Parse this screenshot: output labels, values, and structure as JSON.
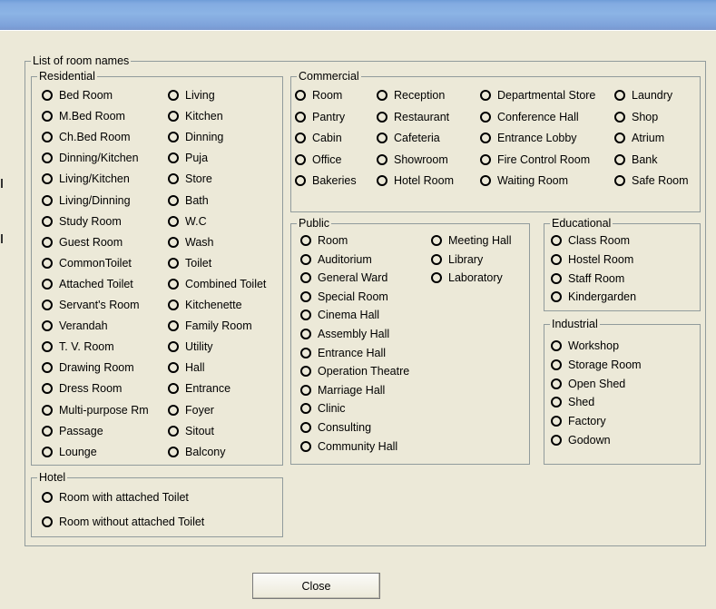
{
  "group_title": "List of room names",
  "residential": {
    "title": "Residential",
    "col1": [
      "Bed Room",
      "M.Bed Room",
      "Ch.Bed Room",
      "Dinning/Kitchen",
      "Living/Kitchen",
      "Living/Dinning",
      "Study Room",
      "Guest Room",
      "CommonToilet",
      "Attached Toilet",
      "Servant's Room",
      "Verandah",
      "T. V. Room",
      "Drawing Room",
      "Dress Room",
      "Multi-purpose Rm",
      "Passage",
      "Lounge"
    ],
    "col2": [
      "Living",
      "Kitchen",
      "Dinning",
      "Puja",
      "Store",
      "Bath",
      "W.C",
      "Wash",
      "Toilet",
      "Combined Toilet",
      "Kitchenette",
      "Family Room",
      "Utility",
      "Hall",
      "Entrance",
      "Foyer",
      "Sitout",
      "Balcony"
    ]
  },
  "commercial": {
    "title": "Commercial",
    "col1": [
      "Room",
      "Pantry",
      "Cabin",
      "Office",
      "Bakeries"
    ],
    "col2": [
      "Reception",
      "Restaurant",
      "Cafeteria",
      "Showroom",
      "Hotel Room"
    ],
    "col3": [
      "Departmental Store",
      "Conference Hall",
      "Entrance Lobby",
      "Fire Control Room",
      "Waiting Room"
    ],
    "col4": [
      "Laundry",
      "Shop",
      "Atrium",
      "Bank",
      "Safe Room"
    ]
  },
  "public": {
    "title": "Public",
    "col1": [
      "Room",
      "Auditorium",
      "General Ward",
      "Special Room",
      "Cinema Hall",
      "Assembly Hall",
      "Entrance Hall",
      "Operation Theatre",
      "Marriage Hall",
      "Clinic",
      "Consulting",
      "Community Hall"
    ],
    "col2": [
      "Meeting Hall",
      "Library",
      "Laboratory"
    ]
  },
  "educational": {
    "title": "Educational",
    "items": [
      "Class Room",
      "Hostel Room",
      "Staff Room",
      "Kindergarden"
    ]
  },
  "industrial": {
    "title": "Industrial",
    "items": [
      "Workshop",
      "Storage Room",
      "Open Shed",
      "Shed",
      "Factory",
      "Godown"
    ]
  },
  "hotel": {
    "title": "Hotel",
    "items": [
      "Room with attached Toilet",
      "Room without attached Toilet"
    ]
  },
  "close_label": "Close"
}
